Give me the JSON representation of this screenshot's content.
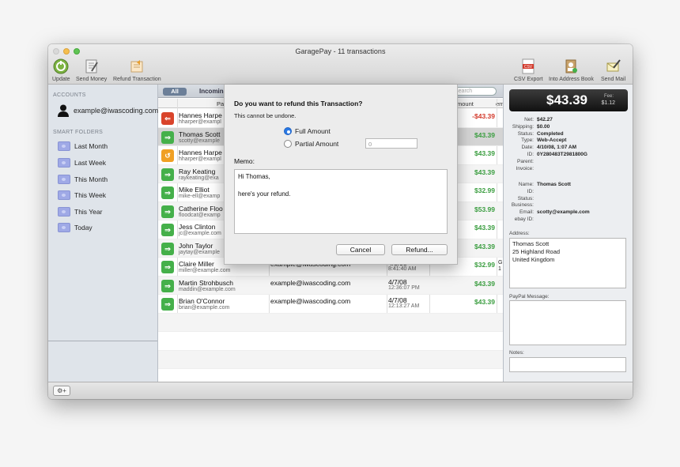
{
  "window": {
    "title": "GaragePay - 11 transactions"
  },
  "toolbar": {
    "update": "Update",
    "send_money": "Send Money",
    "refund_transaction": "Refund Transaction",
    "csv_export": "CSV Export",
    "into_address_book": "Into Address Book",
    "send_mail": "Send Mail"
  },
  "sidebar": {
    "accounts_header": "ACCOUNTS",
    "account": "example@iwascoding.com",
    "smart_folders_header": "SMART FOLDERS",
    "folders": [
      "Last Month",
      "Last Week",
      "This Month",
      "This Week",
      "This Year",
      "Today"
    ]
  },
  "list": {
    "filter_all": "All",
    "filter_incoming": "Incomin",
    "search_placeholder": "Search",
    "col_payer": "Pa",
    "col_amount": "mount",
    "col_em": "em",
    "rows": [
      {
        "name": "Hannes Harpe",
        "email": "hharper@exampl",
        "payer": "",
        "date": "",
        "time": "",
        "amount": "-$43.39",
        "kind": "neg",
        "icon": "red",
        "extra": ""
      },
      {
        "name": "Thomas Scott",
        "email": "scotty@example",
        "payer": "",
        "date": "",
        "time": "",
        "amount": "$43.39",
        "kind": "pos",
        "icon": "grn",
        "extra": ""
      },
      {
        "name": "Hannes Harpe",
        "email": "hharper@exampl",
        "payer": "",
        "date": "",
        "time": "",
        "amount": "$43.39",
        "kind": "pos",
        "icon": "org",
        "extra": ""
      },
      {
        "name": "Ray Keating",
        "email": "raykeating@exa",
        "payer": "",
        "date": "",
        "time": "",
        "amount": "$43.39",
        "kind": "pos",
        "icon": "grn",
        "extra": ""
      },
      {
        "name": "Mike Elliot",
        "email": "mike-ell@examp",
        "payer": "",
        "date": "",
        "time": "",
        "amount": "$32.99",
        "kind": "pos",
        "icon": "grn",
        "extra": ""
      },
      {
        "name": "Catherine Floo",
        "email": "floodcat@examp",
        "payer": "",
        "date": "",
        "time": "",
        "amount": "$53.99",
        "kind": "pos",
        "icon": "grn",
        "extra": ""
      },
      {
        "name": "Jess Clinton",
        "email": "jc@example.com",
        "payer": "",
        "date": "",
        "time": "",
        "amount": "$43.39",
        "kind": "pos",
        "icon": "grn",
        "extra": ""
      },
      {
        "name": "John Taylor",
        "email": "jaytay@example",
        "payer": "",
        "date": "",
        "time": "",
        "amount": "$43.39",
        "kind": "pos",
        "icon": "grn",
        "extra": ""
      },
      {
        "name": "Claire Miller",
        "email": "miller@example.com",
        "payer": "example@iwascoding.com",
        "date": "4/8/08",
        "time": "8:41:40 AM",
        "amount": "$32.99",
        "kind": "pos",
        "icon": "grn",
        "extra": "G\n1"
      },
      {
        "name": "Martin Strohbusch",
        "email": "maddin@example.com",
        "payer": "example@iwascoding.com",
        "date": "4/7/08",
        "time": "12:36:07 PM",
        "amount": "$43.39",
        "kind": "pos",
        "icon": "grn",
        "extra": ""
      },
      {
        "name": "Brian O'Connor",
        "email": "brian@example.com",
        "payer": "example@iwascoding.com",
        "date": "4/7/08",
        "time": "12:13:27 AM",
        "amount": "$43.39",
        "kind": "pos",
        "icon": "grn",
        "extra": ""
      }
    ]
  },
  "detail": {
    "amount": "$43.39",
    "fee_label": "Fee:",
    "fee_value": "$1.12",
    "fields1": [
      {
        "k": "Net:",
        "v": "$42.27"
      },
      {
        "k": "Shipping:",
        "v": "$0.00"
      },
      {
        "k": "Status:",
        "v": "Completed"
      },
      {
        "k": "Type:",
        "v": "Web-Accept"
      },
      {
        "k": "Date:",
        "v": "4/10/08, 1:07 AM"
      },
      {
        "k": "ID:",
        "v": "0Y280483T2981800G"
      },
      {
        "k": "Parent:",
        "v": ""
      },
      {
        "k": "Invoice:",
        "v": ""
      }
    ],
    "fields2": [
      {
        "k": "Name:",
        "v": "Thomas Scott"
      },
      {
        "k": "ID:",
        "v": ""
      },
      {
        "k": "Status:",
        "v": ""
      },
      {
        "k": "Business:",
        "v": ""
      },
      {
        "k": "Email:",
        "v": "scotty@example.com"
      },
      {
        "k": "ebay ID:",
        "v": ""
      }
    ],
    "address_label": "Address:",
    "address": "Thomas Scott\n25 Highland Road\nUnited Kingdom",
    "paypal_message_label": "PayPal Message:",
    "notes_label": "Notes:"
  },
  "dialog": {
    "title": "Do you want to refund this Transaction?",
    "subtitle": "This cannot be undone.",
    "full_amount": "Full Amount",
    "partial_amount": "Partial Amount",
    "partial_value": "0",
    "memo_label": "Memo:",
    "memo_text": "Hi Thomas,\n\nhere's your refund.",
    "cancel": "Cancel",
    "refund": "Refund..."
  },
  "colors": {
    "positive": "#3a9d3f",
    "negative": "#d33a2c",
    "accent": "#2a79e4"
  }
}
